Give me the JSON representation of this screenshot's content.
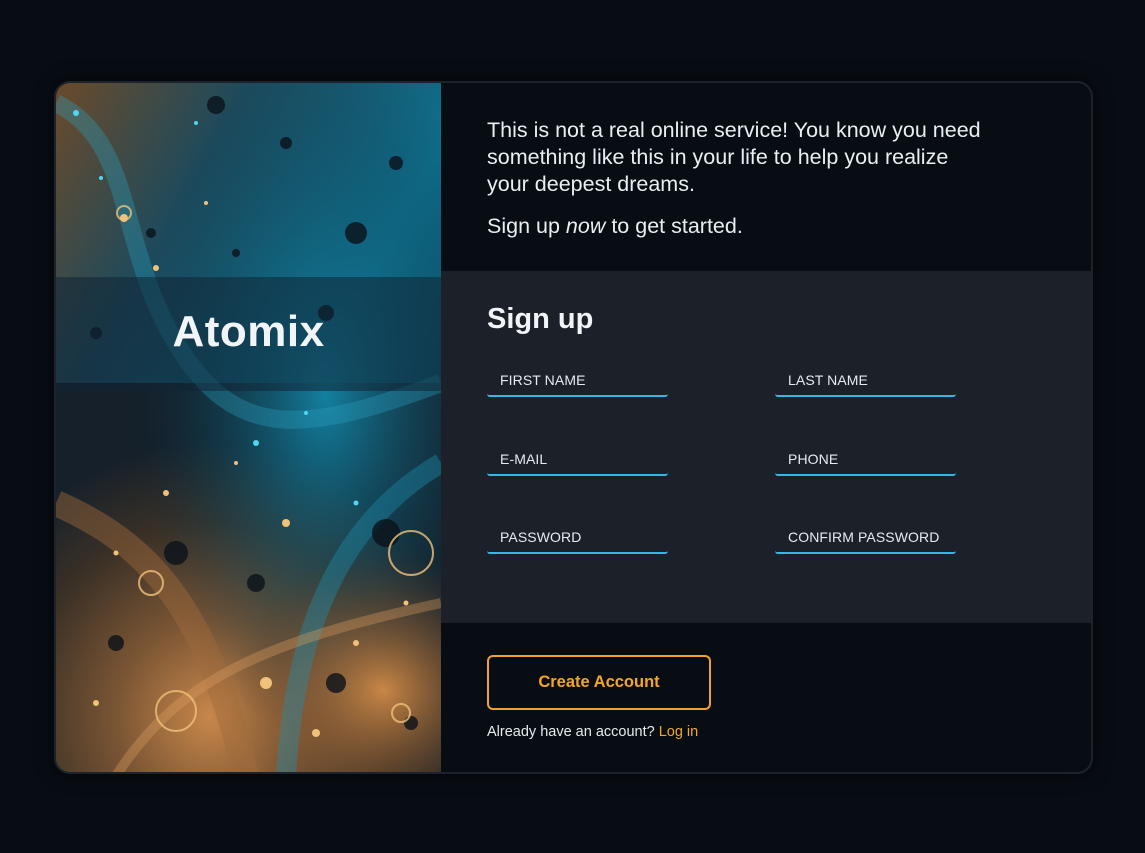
{
  "brand": {
    "name": "Atomix"
  },
  "intro": {
    "line1": "This is not a real online service! You know you need something like this in your life to help you realize your deepest dreams.",
    "cta_before": "Sign up ",
    "cta_em": "now",
    "cta_after": " to get started."
  },
  "form": {
    "title": "Sign up",
    "fields": [
      {
        "label": "FIRST NAME",
        "value": ""
      },
      {
        "label": "LAST NAME",
        "value": ""
      },
      {
        "label": "E-MAIL",
        "value": ""
      },
      {
        "label": "PHONE",
        "value": ""
      },
      {
        "label": "PASSWORD",
        "value": ""
      },
      {
        "label": "CONFIRM PASSWORD",
        "value": ""
      }
    ]
  },
  "actions": {
    "submit_label": "Create Account",
    "login_prompt": "Already have an account?",
    "login_link": "Log in"
  },
  "colors": {
    "background": "#080d14",
    "panel": "#1c2129",
    "accent_orange": "#f5a623",
    "accent_blue": "#38b6e6",
    "text": "#e9eef3"
  }
}
